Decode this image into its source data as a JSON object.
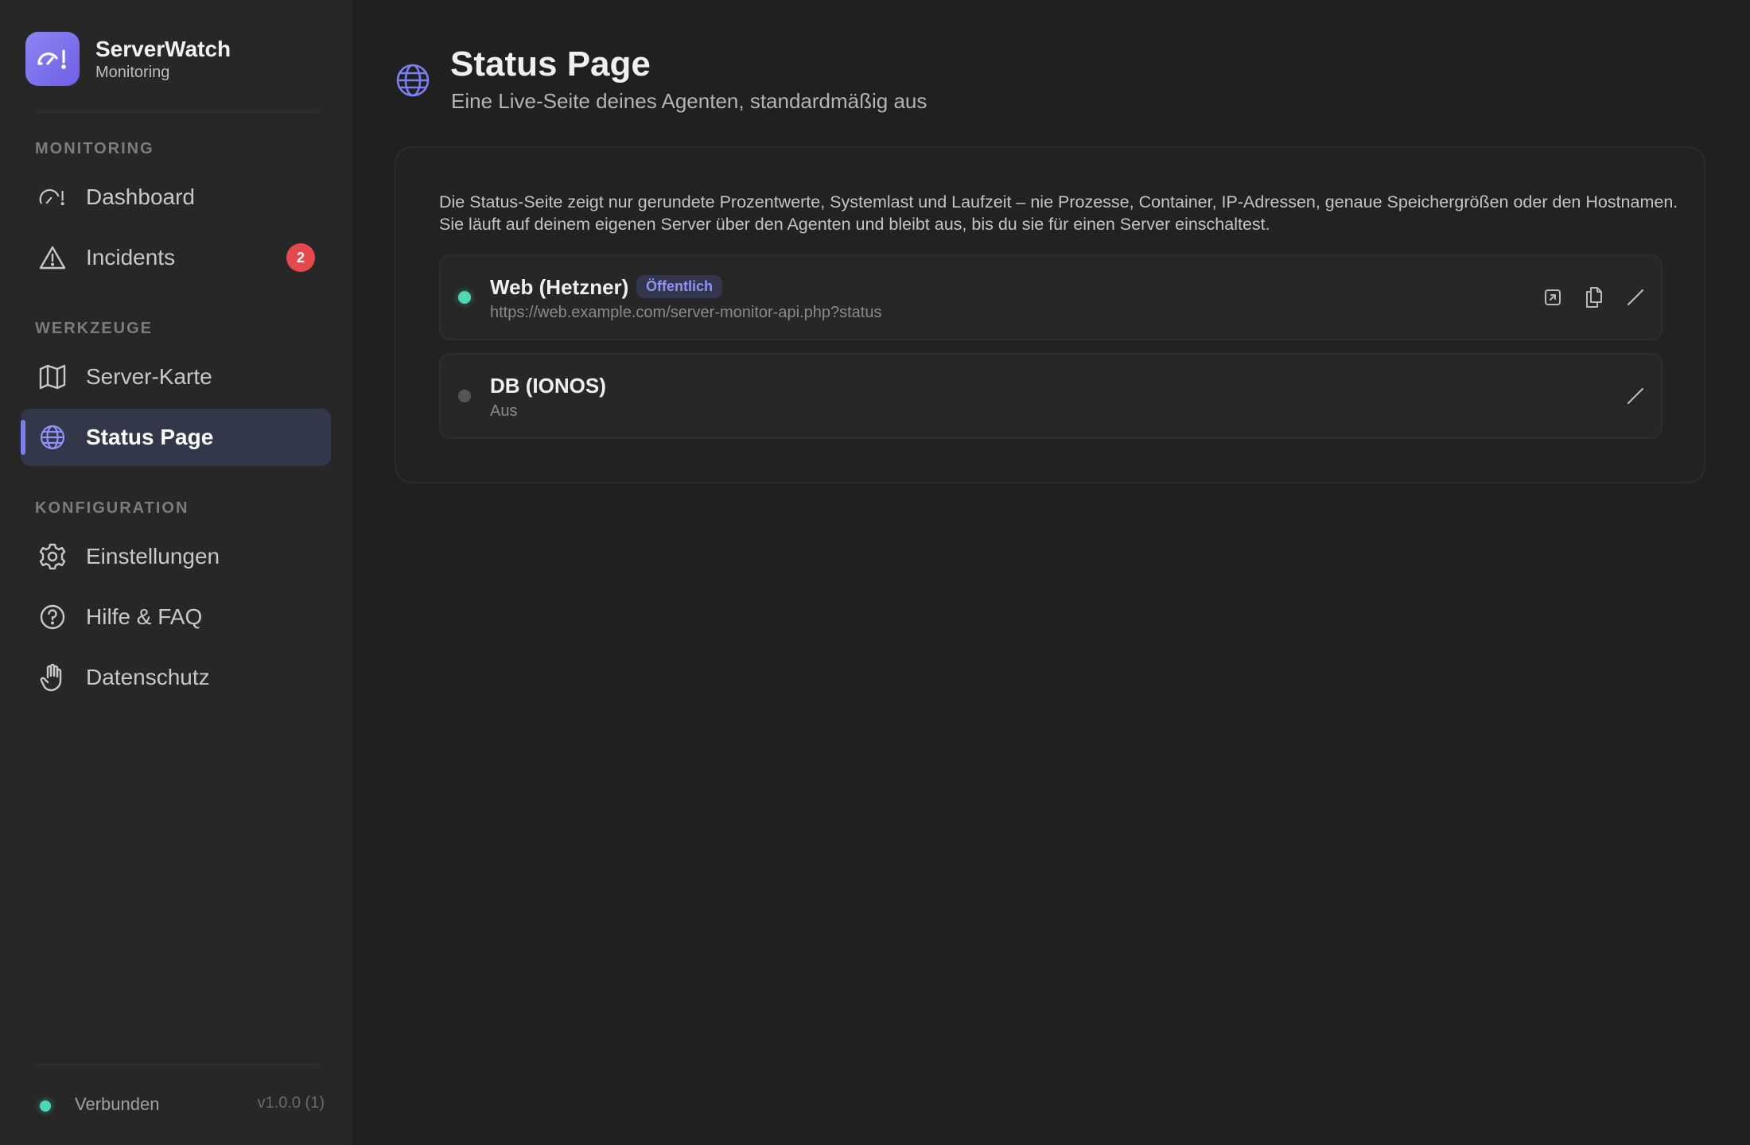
{
  "app": {
    "name": "ServerWatch",
    "subtitle": "Monitoring"
  },
  "sidebar": {
    "sections": [
      {
        "label": "MONITORING"
      },
      {
        "label": "WERKZEUGE"
      },
      {
        "label": "KONFIGURATION"
      }
    ],
    "items": [
      {
        "label": "Dashboard",
        "icon": "gauge-icon"
      },
      {
        "label": "Incidents",
        "icon": "warning-icon",
        "badge": "2"
      },
      {
        "label": "Server-Karte",
        "icon": "map-icon"
      },
      {
        "label": "Status Page",
        "icon": "globe-icon",
        "active": true
      },
      {
        "label": "Einstellungen",
        "icon": "gear-icon"
      },
      {
        "label": "Hilfe & FAQ",
        "icon": "help-icon"
      },
      {
        "label": "Datenschutz",
        "icon": "hand-icon"
      }
    ],
    "footer": {
      "status": "Verbunden",
      "version": "v1.0.0 (1)"
    }
  },
  "page": {
    "title": "Status Page",
    "subtitle": "Eine Live-Seite deines Agenten, standardmäßig aus",
    "description": "Die Status-Seite zeigt nur gerundete Prozentwerte, Systemlast und Laufzeit – nie Prozesse, Container, IP-Adressen, genaue Speichergrößen oder den Hostnamen. Sie läuft auf deinem eigenen Server über den Agenten und bleibt aus, bis du sie für einen Server einschaltest."
  },
  "servers": [
    {
      "name": "Web (Hetzner)",
      "badge": "Öffentlich",
      "detail": "https://web.example.com/server-monitor-api.php?status",
      "status_color": "#4fd6b3"
    },
    {
      "name": "DB (IONOS)",
      "detail": "Aus",
      "status_color": "#555555"
    }
  ],
  "colors": {
    "accent": "#7b7ff0",
    "online": "#4fd6b3",
    "badge": "#e5484d"
  }
}
